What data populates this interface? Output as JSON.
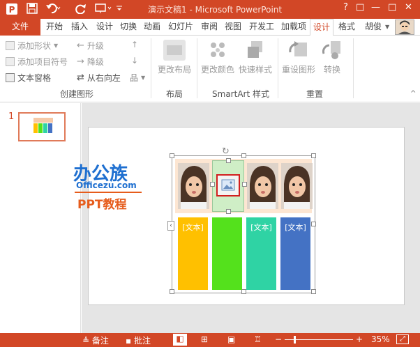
{
  "window": {
    "title": "演示文稿1 - Microsoft PowerPoint",
    "help": "?",
    "restore": "□",
    "minimize": "—",
    "maximize": "□",
    "close": "✕"
  },
  "tabs": [
    {
      "label": "文件"
    },
    {
      "label": "开始"
    },
    {
      "label": "插入"
    },
    {
      "label": "设计"
    },
    {
      "label": "切换"
    },
    {
      "label": "动画"
    },
    {
      "label": "幻灯片"
    },
    {
      "label": "审阅"
    },
    {
      "label": "视图"
    },
    {
      "label": "开发工"
    },
    {
      "label": "加载项"
    },
    {
      "label": "设计"
    },
    {
      "label": "格式"
    }
  ],
  "user": {
    "name": "胡俊"
  },
  "ribbon": {
    "create_graphic": {
      "label": "创建图形",
      "add_shape": "添加形状",
      "add_bullet": "添加项目符号",
      "text_pane": "文本窗格",
      "promote": "升级",
      "demote": "降级",
      "right_to_left": "从右向左"
    },
    "layout": {
      "label": "布局",
      "change_layout": "更改布局"
    },
    "smartart_styles": {
      "label": "SmartArt 样式",
      "change_colors": "更改颜色",
      "quick_styles": "快速样式"
    },
    "reset": {
      "label": "重置",
      "reset_graphic": "重设图形",
      "convert": "转换"
    }
  },
  "thumbnail": {
    "number": "1"
  },
  "watermark": {
    "brand": "办公族",
    "site": "Officezu.com",
    "tagline": "PPT教程"
  },
  "smartart": {
    "items": [
      {
        "text": "[文本]",
        "color": "#ffc000"
      },
      {
        "text": "",
        "color": "#54e11c"
      },
      {
        "text": "[文本]",
        "color": "#2fd3a4"
      },
      {
        "text": "[文本]",
        "color": "#4472c4"
      }
    ]
  },
  "status": {
    "notes": "备注",
    "comments": "批注",
    "zoom_out": "−",
    "zoom_in": "+",
    "zoom": "35%"
  },
  "colors": {
    "accent": "#d24726",
    "header_bg": "#fde6d2",
    "selected_bg": "#cfeec6"
  }
}
